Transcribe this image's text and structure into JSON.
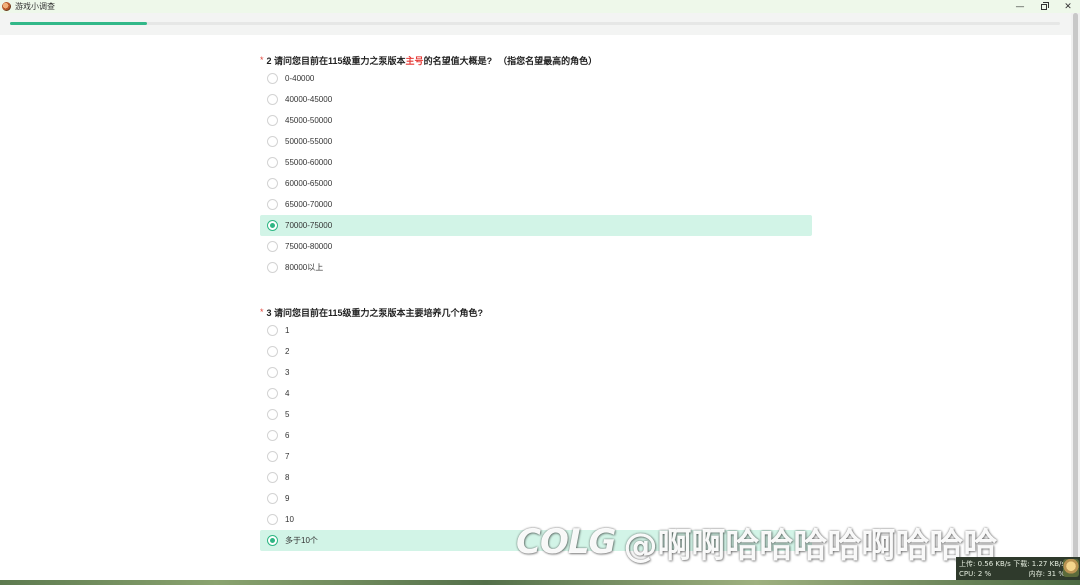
{
  "window": {
    "title": "游戏小调查",
    "icon": "app-icon",
    "controls": {
      "minimize": "—",
      "close": "✕"
    }
  },
  "progress": {
    "fraction": 0.13
  },
  "questions": [
    {
      "required_mark": "*",
      "title_prefix": "2 请问您目前在115级重力之泵版本",
      "title_highlight": "主号",
      "title_suffix": "的名望值大概是?",
      "title_note": "（指您名望最高的角色）",
      "options": [
        {
          "label": "0-40000",
          "selected": false
        },
        {
          "label": "40000-45000",
          "selected": false
        },
        {
          "label": "45000-50000",
          "selected": false
        },
        {
          "label": "50000-55000",
          "selected": false
        },
        {
          "label": "55000-60000",
          "selected": false
        },
        {
          "label": "60000-65000",
          "selected": false
        },
        {
          "label": "65000-70000",
          "selected": false
        },
        {
          "label": "70000-75000",
          "selected": true
        },
        {
          "label": "75000-80000",
          "selected": false
        },
        {
          "label": "80000以上",
          "selected": false
        }
      ]
    },
    {
      "required_mark": "*",
      "title_prefix": "3 请问您目前在115级重力之泵版本主要培养几个角色?",
      "title_highlight": "",
      "title_suffix": "",
      "title_note": "",
      "options": [
        {
          "label": "1",
          "selected": false
        },
        {
          "label": "2",
          "selected": false
        },
        {
          "label": "3",
          "selected": false
        },
        {
          "label": "4",
          "selected": false
        },
        {
          "label": "5",
          "selected": false
        },
        {
          "label": "6",
          "selected": false
        },
        {
          "label": "7",
          "selected": false
        },
        {
          "label": "8",
          "selected": false
        },
        {
          "label": "9",
          "selected": false
        },
        {
          "label": "10",
          "selected": false
        },
        {
          "label": "多于10个",
          "selected": true
        }
      ]
    }
  ],
  "watermark": {
    "logo": "COLG",
    "user": "@啊啊哈哈哈哈啊哈哈哈"
  },
  "netmon": {
    "upload": "上传: 0.56 KB/s",
    "download": "下载: 1.27 KB/s",
    "cpu": "CPU: 2 %",
    "memory": "内存: 31 %"
  },
  "colors": {
    "accent": "#32b889",
    "selected_bg": "#d2f4e7",
    "required": "#e0463c",
    "highlight": "#e53935"
  }
}
